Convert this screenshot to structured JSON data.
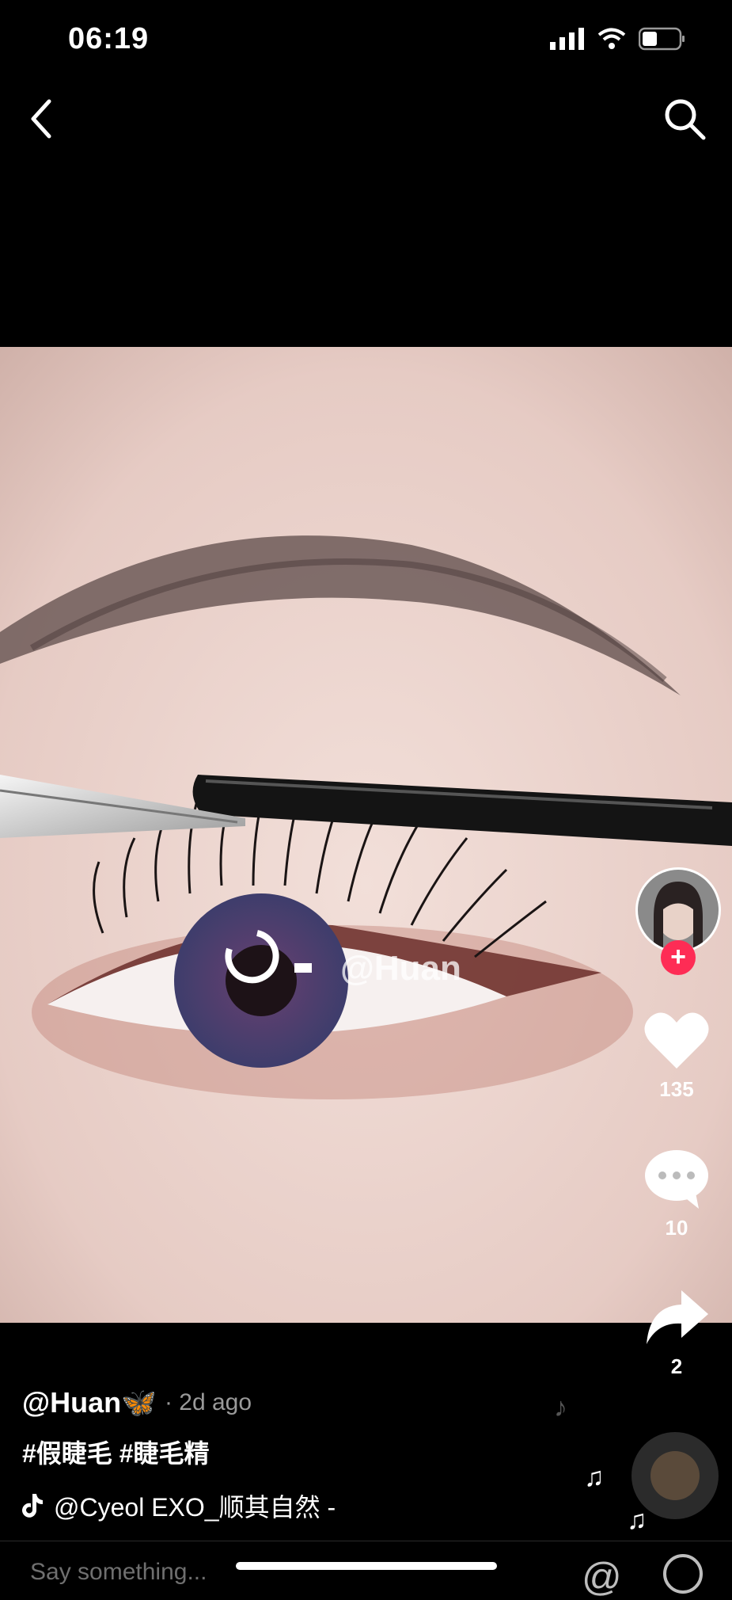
{
  "status": {
    "time": "06:19"
  },
  "video": {
    "watermark": "@Huan"
  },
  "actions": {
    "likes": "135",
    "comments": "10",
    "shares": "2"
  },
  "caption": {
    "author": "@Huan🦋",
    "ago": "· 2d ago",
    "hashtags": "#假睫毛 #睫毛精",
    "music": "@Cyeol    EXO_顺其自然 -"
  },
  "comment_input": {
    "placeholder": "Say something..."
  },
  "colors": {
    "follow": "#fe2c55",
    "background": "#000000"
  }
}
